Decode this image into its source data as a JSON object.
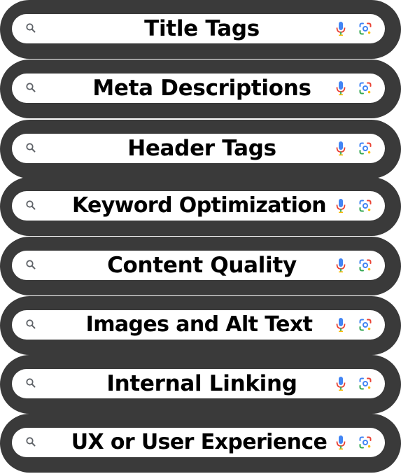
{
  "search_bars": [
    {
      "label": "Title Tags"
    },
    {
      "label": "Meta Descriptions"
    },
    {
      "label": "Header Tags"
    },
    {
      "label": "Keyword Optimization"
    },
    {
      "label": "Content Quality"
    },
    {
      "label": "Images and Alt Text"
    },
    {
      "label": "Internal Linking"
    },
    {
      "label": "UX or User Experience"
    }
  ],
  "icons": {
    "left": "search-icon",
    "right_1": "microphone-icon",
    "right_2": "google-lens-icon"
  },
  "colors": {
    "outer_pill": "#3a3a3a",
    "inner_pill": "#ffffff",
    "text": "#000000",
    "mic_blue": "#4285f4",
    "mic_red": "#ea4335",
    "lens_blue": "#4285f4",
    "lens_red": "#ea4335",
    "lens_yellow": "#fbbc05",
    "lens_green": "#34a853"
  }
}
